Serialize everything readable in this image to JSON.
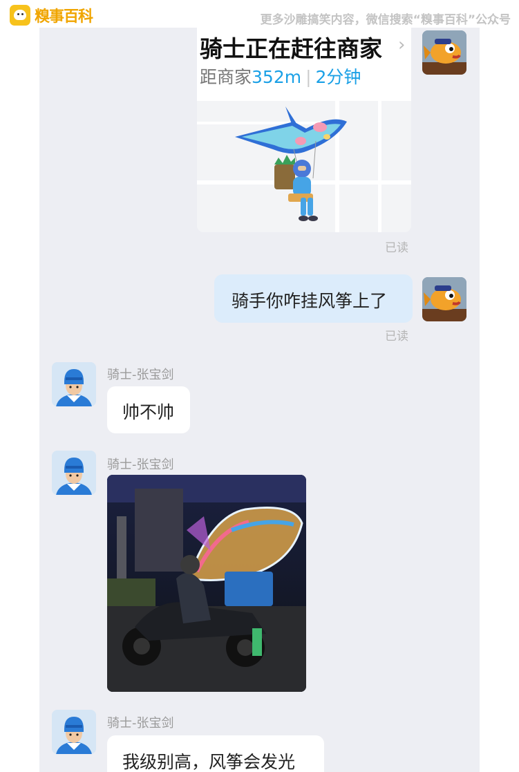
{
  "watermark": {
    "brand": "糗事百科",
    "notice": "更多沙雕搞笑内容，微信搜索“糗事百科”公众号"
  },
  "order_card": {
    "title": "骑士正在赶往商家",
    "distance_label": "距商家",
    "distance_value": "352m",
    "eta": "2分钟",
    "illustration_icon": "kite-rider-illustration",
    "accent_color": "#1aa0e6"
  },
  "messages": [
    {
      "type": "card",
      "direction": "outgoing",
      "status": "已读"
    },
    {
      "type": "text",
      "direction": "outgoing",
      "text": "骑手你咋挂风筝上了",
      "status": "已读"
    },
    {
      "type": "text",
      "direction": "incoming",
      "sender": "骑士-张宝剑",
      "text": "帅不帅"
    },
    {
      "type": "image",
      "direction": "incoming",
      "sender": "骑士-张宝剑",
      "image_icon": "glowing-kite-motorbike-photo"
    },
    {
      "type": "text",
      "direction": "incoming",
      "sender": "骑士-张宝剑",
      "text": "我级别高，风筝会发光"
    }
  ],
  "colors": {
    "chat_background": "#edeef3",
    "outgoing_bubble": "#dcecfb",
    "incoming_bubble": "#ffffff",
    "watermark_brand": "#f0a500"
  }
}
